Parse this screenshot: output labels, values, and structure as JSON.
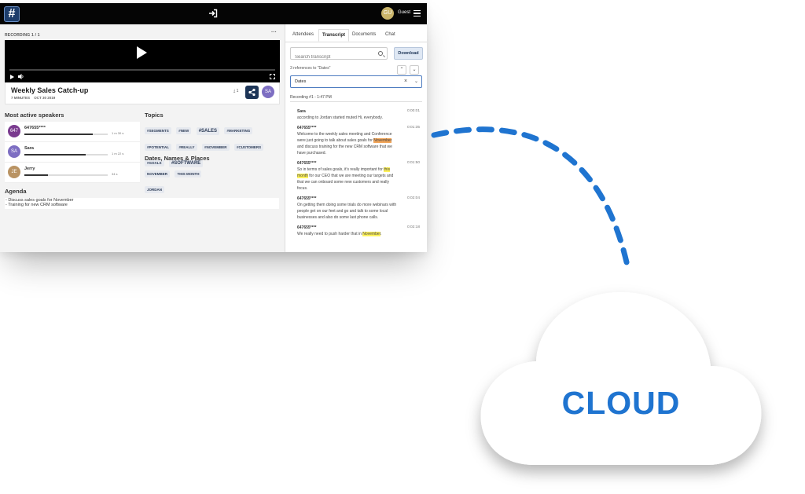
{
  "header": {
    "logo_glyph": "#",
    "user_initials": "GU",
    "user_name": "Guest"
  },
  "recording": {
    "label": "RECORDING 1 / 1",
    "more": "···",
    "title": "Weekly Sales Catch-up",
    "duration": "7 MINUTES",
    "date": "OCT 30 2019",
    "download_count": "1",
    "owner_initials": "SA"
  },
  "speakers": {
    "heading": "Most active speakers",
    "items": [
      {
        "initials": "647",
        "name": "647655****",
        "time": "1 m 30 s",
        "share": 0.82,
        "color": "#7a3b8f"
      },
      {
        "initials": "SA",
        "name": "Sara",
        "time": "1 m 22 s",
        "share": 0.74,
        "color": "#7d6ec2"
      },
      {
        "initials": "JE",
        "name": "Jerry",
        "time": "34 s",
        "share": 0.28,
        "color": "#b99363"
      }
    ]
  },
  "topics": {
    "heading": "Topics",
    "tags": [
      "#SEGMENTS",
      "#NEW",
      "#SALES",
      "#MARKETING",
      "#POTENTIAL",
      "#REALLY",
      "#NOVEMBER",
      "#CUSTOMERS",
      "#GOALS",
      "#SOFTWARE"
    ]
  },
  "dates_names_places": {
    "heading": "Dates, Names & Places",
    "tags": [
      "NOVEMBER",
      "THIS MONTH",
      "JORDAN"
    ]
  },
  "agenda": {
    "heading": "Agenda",
    "lines": [
      "- Discuss sales goals for November",
      "- Training for new CRM software"
    ]
  },
  "tabs": [
    "Attendees",
    "Transcript",
    "Documents",
    "Chat"
  ],
  "transcript": {
    "search_placeholder": "Search transcript",
    "download_label": "Download",
    "references": "3 references to \"Dates\"",
    "filter_value": "Dates",
    "recording_header": "Recording #1 - 1:47 PM",
    "entries": [
      {
        "name": "Sara",
        "time": "0:00:01",
        "text": "according to Jordan started muted Hi, everybody."
      },
      {
        "name": "647655****",
        "time": "0:01:35",
        "text_before": "Welcome to the weekly sales meeting and Conference were just going to talk about sales goals for ",
        "highlight": "November",
        "text_after": " and discuss training for the new CRM software that we have purchased."
      },
      {
        "name": "647655****",
        "time": "0:01:50",
        "text_before": "So in terms of sales goals, it's really important for ",
        "highlight": "this month",
        "text_after": " for our CEO that we are meeting our targets and that we can onboard some new customers and really focus."
      },
      {
        "name": "647655****",
        "time": "0:02:04",
        "text": "On getting them doing some trials do more webinars with people get on our feet and go and talk to some local businesses and also do some last phone calls."
      },
      {
        "name": "647655****",
        "time": "0:02:18",
        "text_before": "We really need to push harder that in ",
        "highlight": "November",
        "text_after": "."
      }
    ]
  },
  "cloud": {
    "label": "CLOUD",
    "color": "#1f74d0"
  }
}
